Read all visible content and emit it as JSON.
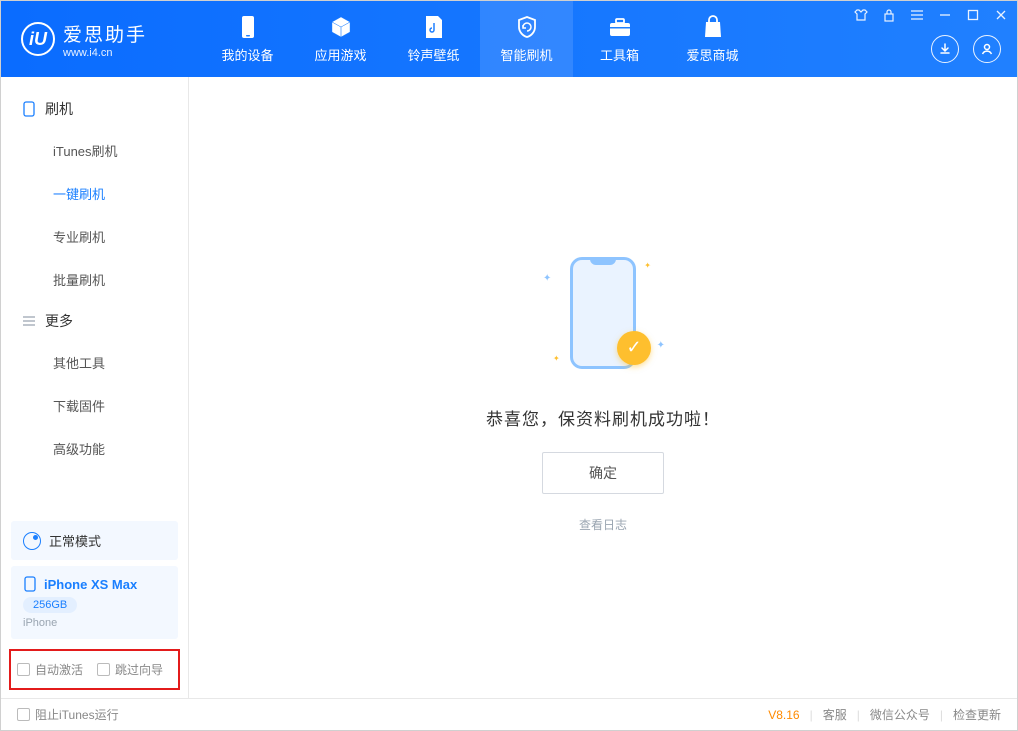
{
  "app": {
    "name": "爱思助手",
    "url": "www.i4.cn"
  },
  "nav": {
    "tabs": [
      {
        "label": "我的设备"
      },
      {
        "label": "应用游戏"
      },
      {
        "label": "铃声壁纸"
      },
      {
        "label": "智能刷机"
      },
      {
        "label": "工具箱"
      },
      {
        "label": "爱思商城"
      }
    ]
  },
  "sidebar": {
    "group1_title": "刷机",
    "group1_items": [
      {
        "label": "iTunes刷机"
      },
      {
        "label": "一键刷机"
      },
      {
        "label": "专业刷机"
      },
      {
        "label": "批量刷机"
      }
    ],
    "group2_title": "更多",
    "group2_items": [
      {
        "label": "其他工具"
      },
      {
        "label": "下载固件"
      },
      {
        "label": "高级功能"
      }
    ]
  },
  "device": {
    "mode_label": "正常模式",
    "name": "iPhone XS Max",
    "storage": "256GB",
    "type": "iPhone"
  },
  "options": {
    "auto_activate": "自动激活",
    "skip_guide": "跳过向导"
  },
  "main": {
    "success_text": "恭喜您，保资料刷机成功啦！",
    "ok_button": "确定",
    "view_log": "查看日志"
  },
  "footer": {
    "block_itunes": "阻止iTunes运行",
    "version": "V8.16",
    "support": "客服",
    "wechat": "微信公众号",
    "check_update": "检查更新"
  }
}
